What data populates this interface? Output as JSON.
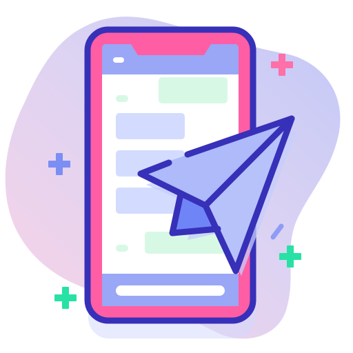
{
  "illustration": {
    "subject": "mobile-phone-with-paper-plane",
    "icons": {
      "phone": "smartphone-icon",
      "plane": "paper-plane-icon",
      "sparkle": "sparkle-icon"
    }
  },
  "colors": {
    "outline": "#3730b8",
    "phone_frame": "#ff5ea4",
    "screen": "#ffffff",
    "header_bar": "#9aa6f6",
    "incoming_bubble": "#d3dcff",
    "outgoing_bubble": "#d8f8e6",
    "plane_wing_light": "#aebaf9",
    "plane_wing_dark": "#6f85f7",
    "sparkle_pink": "#ff6fa8",
    "sparkle_blue": "#7b8ef4",
    "sparkle_green": "#27e2a4",
    "blob_gradient_start": "#f9d3e6",
    "blob_gradient_end": "#c7cbf6"
  }
}
